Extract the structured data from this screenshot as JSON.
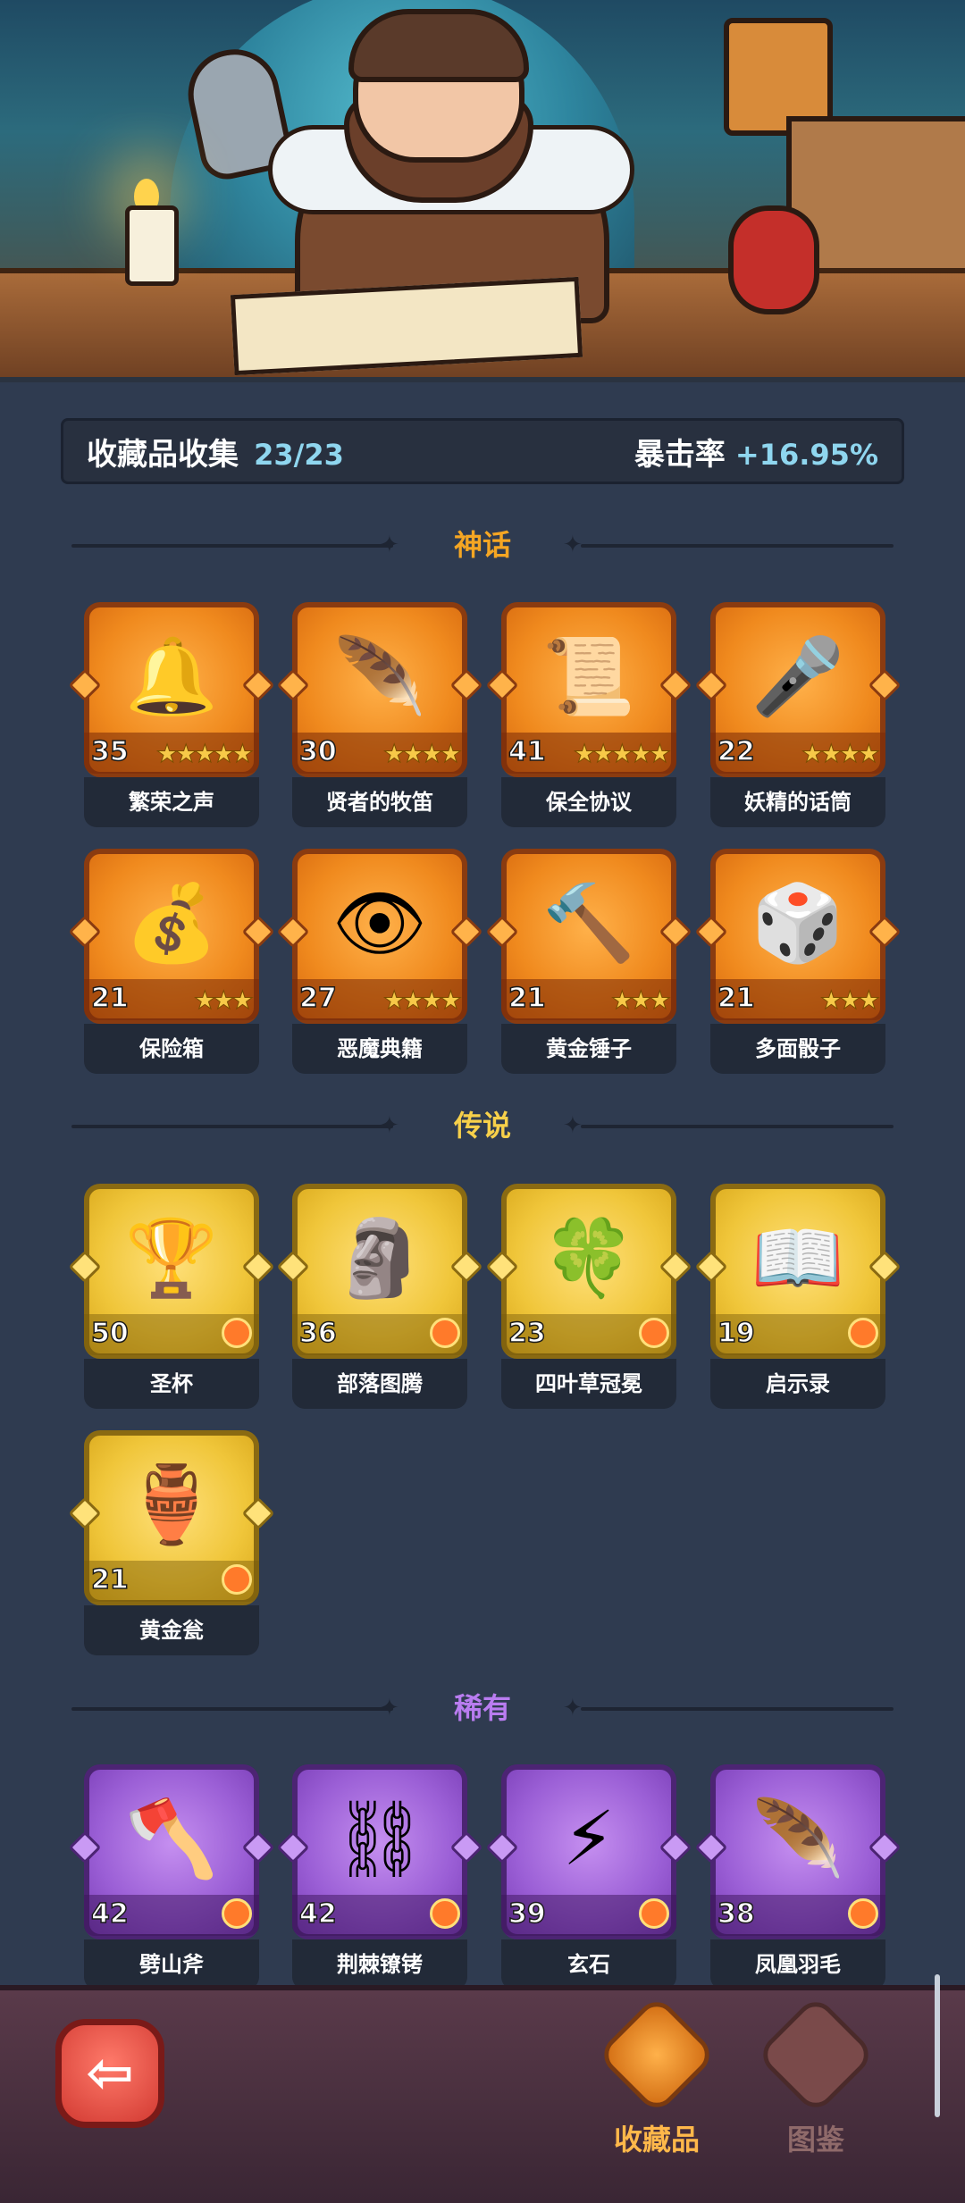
{
  "stats": {
    "label": "收藏品收集",
    "count": "23/23",
    "crit_label": "暴击率",
    "crit_value": "+16.95%"
  },
  "sections": [
    {
      "title": "神话",
      "color": "#f5a623"
    },
    {
      "title": "传说",
      "color": "#f7d04a"
    },
    {
      "title": "稀有",
      "color": "#b97cf0"
    }
  ],
  "myth": [
    {
      "name": "繁荣之声",
      "level": "35",
      "stars": "★★★★★",
      "icon": "🔔"
    },
    {
      "name": "贤者的牧笛",
      "level": "30",
      "stars": "★★★★",
      "icon": "🪶"
    },
    {
      "name": "保全协议",
      "level": "41",
      "stars": "★★★★★",
      "icon": "📜"
    },
    {
      "name": "妖精的话筒",
      "level": "22",
      "stars": "★★★★",
      "icon": "🎤"
    },
    {
      "name": "保险箱",
      "level": "21",
      "stars": "★★★",
      "icon": "💰"
    },
    {
      "name": "恶魔典籍",
      "level": "27",
      "stars": "★★★★",
      "icon": "👁"
    },
    {
      "name": "黄金锤子",
      "level": "21",
      "stars": "★★★",
      "icon": "🔨"
    },
    {
      "name": "多面骰子",
      "level": "21",
      "stars": "★★★",
      "icon": "🎲"
    }
  ],
  "legend": [
    {
      "name": "圣杯",
      "level": "50",
      "icon": "🏆"
    },
    {
      "name": "部落图腾",
      "level": "36",
      "icon": "🗿"
    },
    {
      "name": "四叶草冠冕",
      "level": "23",
      "icon": "🍀"
    },
    {
      "name": "启示录",
      "level": "19",
      "icon": "📖"
    },
    {
      "name": "黄金瓮",
      "level": "21",
      "icon": "🏺"
    }
  ],
  "rare": [
    {
      "name": "劈山斧",
      "level": "42",
      "icon": "🪓"
    },
    {
      "name": "荆棘镣铐",
      "level": "42",
      "icon": "⛓"
    },
    {
      "name": "玄石",
      "level": "39",
      "icon": "⚡"
    },
    {
      "name": "凤凰羽毛",
      "level": "38",
      "icon": "🪶"
    }
  ],
  "nav": {
    "collection": "收藏品",
    "codex": "图鉴"
  }
}
